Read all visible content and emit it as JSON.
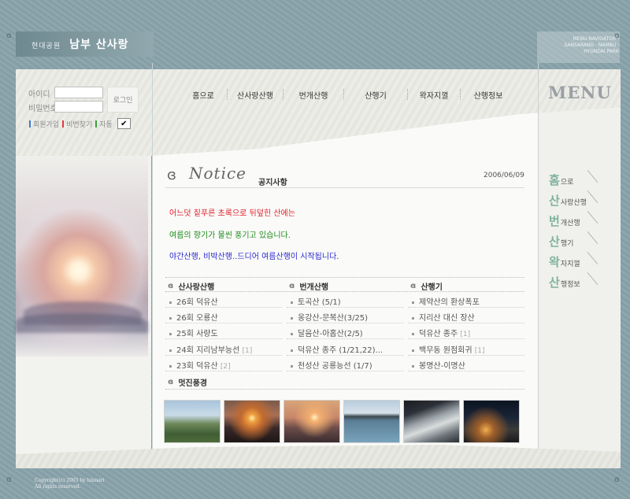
{
  "header": {
    "title_small": "현대공원",
    "title_big": "남부 산사랑",
    "top_right_text": "MENU NAVIGATOR · SANSARANG · NAMBU · HYUNDAI PARK"
  },
  "login": {
    "id_label": "아이디",
    "pw_label": "비밀번호",
    "button": "로그인",
    "link_join": "회원가입",
    "link_find": "비번찾기",
    "link_auto": "자동",
    "auto_checked": "✔"
  },
  "nav": {
    "items": [
      "홈으로",
      "산사랑산행",
      "번개산행",
      "산행기",
      "왁자지껄",
      "산행정보"
    ]
  },
  "menu_word": "MENU",
  "notice": {
    "ornament": "ɞ",
    "word": "Notice",
    "title": "공지사항",
    "date": "2006/06/09",
    "messages": [
      {
        "text": "어느덧 짙푸른 초록으로 뒤덮힌 산에는",
        "color": "#e0202a"
      },
      {
        "text": "여름의 향기가 물씬 풍기고 있습니다.",
        "color": "#1a8a1a"
      },
      {
        "text": "야간산행, 비박산행..드디어 여름산행이 시작됩니다.",
        "color": "#2a2ad0"
      }
    ]
  },
  "boards": [
    {
      "title": "산사랑산행",
      "items": [
        {
          "text": "26회 덕유산",
          "count": ""
        },
        {
          "text": "26회 오룡산",
          "count": ""
        },
        {
          "text": "25회 사량도",
          "count": ""
        },
        {
          "text": "24회 지리남부능선",
          "count": "[1]"
        },
        {
          "text": "23회 덕유산",
          "count": "[2]"
        }
      ]
    },
    {
      "title": "번개산행",
      "items": [
        {
          "text": "토곡산 (5/1)",
          "count": ""
        },
        {
          "text": "옹강산-문복산(3/25)",
          "count": ""
        },
        {
          "text": "달음산-아홉산(2/5)",
          "count": ""
        },
        {
          "text": "덕유산 종주 (1/21,22)...",
          "count": ""
        },
        {
          "text": "천성산 공룡능선 (1/7)",
          "count": ""
        }
      ]
    },
    {
      "title": "산행기",
      "items": [
        {
          "text": "제약산의 환상폭포",
          "count": ""
        },
        {
          "text": "지리산 대신 장산",
          "count": ""
        },
        {
          "text": "덕유산 종주",
          "count": "[1]"
        },
        {
          "text": "백무동 원점회귀",
          "count": "[1]"
        },
        {
          "text": "봉명산-이명산",
          "count": ""
        }
      ]
    }
  ],
  "gallery": {
    "title": "멋진풍경"
  },
  "right_menu": [
    {
      "first": "홈",
      "rest": "으로"
    },
    {
      "first": "산",
      "rest": "사랑산행"
    },
    {
      "first": "번",
      "rest": "개산행"
    },
    {
      "first": "산",
      "rest": "행기"
    },
    {
      "first": "왁",
      "rest": "자지껄"
    },
    {
      "first": "산",
      "rest": "행정보"
    }
  ],
  "footer": {
    "line1": "Copyright(c) 2005 by hinnari",
    "line2": "All rights reserved."
  },
  "colors": {
    "frame": "#8aa2aa",
    "accent_green": "#7fb2a0"
  }
}
